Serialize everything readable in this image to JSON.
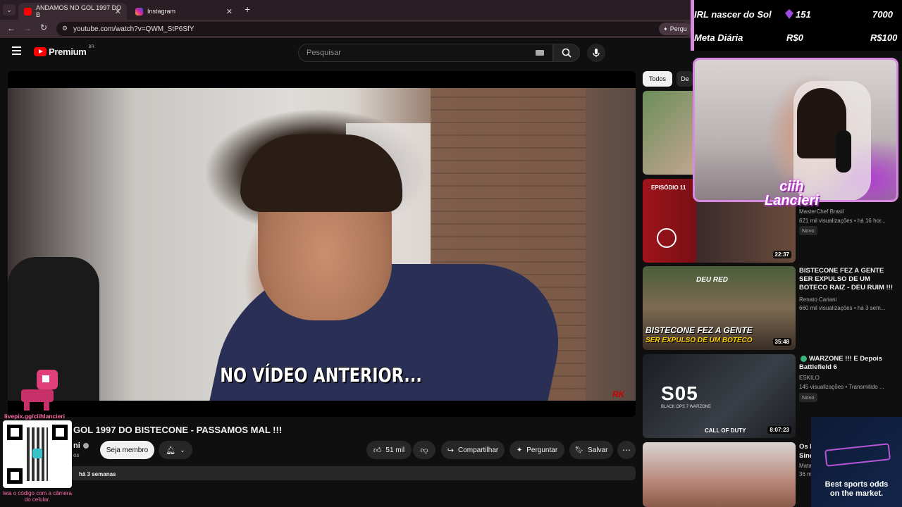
{
  "browser": {
    "tabs": [
      {
        "label": "ANDAMOS NO GOL 1997 DO B",
        "favicon": "youtube-icon",
        "active": true
      },
      {
        "label": "Instagram",
        "favicon": "instagram-icon",
        "active": false
      }
    ],
    "url": "youtube.com/watch?v=QWM_StP6SfY",
    "right_button": "Pergu"
  },
  "youtube": {
    "logo_text": "Premium",
    "logo_superscript": "BR",
    "search_placeholder": "Pesquisar",
    "video": {
      "subtitle": "NO VÍDEO ANTERIOR...",
      "title": "GOL 1997 DO BISTECONE - PASSAMOS MAL !!!",
      "channel_partial": "ni",
      "channel_sub_partial": "os",
      "date_partial": "há 3 semanas",
      "join_label": "Seja membro",
      "like_count": "51 mil",
      "share_label": "Compartilhar",
      "ask_label": "Perguntar",
      "save_label": "Salvar"
    },
    "chips": [
      {
        "label": "Todos",
        "active": true
      },
      {
        "label": "De",
        "active": false
      }
    ],
    "recommendations": [
      {
        "title": "",
        "channel": "MasterChef Brasil",
        "meta": "621 mil visualizações • há 16 hor...",
        "badge": "Novo",
        "duration": "22:37",
        "thumb_text": "EPISÓDIO 11"
      },
      {
        "title": "BISTECONE FEZ A GENTE SER EXPULSO DE UM BOTECO RAIZ - DEU RUIM !!!",
        "channel": "Renato Cariani",
        "meta": "660 mil visualizações • há 3 sem...",
        "duration": "35:48",
        "thumb_text_top": "DEU RED",
        "thumb_text_1": "BISTECONE FEZ A GENTE",
        "thumb_text_2": "SER EXPULSO DE UM BOTECO"
      },
      {
        "title": "WARZONE !!! E Depois Battlefield 6",
        "channel": "ESKILO",
        "meta": "145 visualizações • Transmitido ...",
        "badge": "Novo",
        "duration": "8:07:23",
        "thumb_text": "S05",
        "thumb_sub": "BLACK OPS 7 WARZONE",
        "thumb_brand": "CALL OF DUTY"
      },
      {
        "title": "Os I",
        "title2": "Sinc",
        "channel": "Mata",
        "meta": "36 m"
      }
    ]
  },
  "overlay": {
    "goal_label": "IRL nascer do Sol",
    "goal_current": "151",
    "goal_target": "7000",
    "meta_label": "Meta Diária",
    "meta_current": "R$0",
    "meta_target": "R$100",
    "cam_name_1": "ciih",
    "cam_name_2": "Lancieri",
    "livepix": "livepix.gg/ciihlancieri",
    "qr_caption": "leia o código com a câmera do celular.",
    "sponsor_line1": "Best sports odds",
    "sponsor_line2": "on the market."
  },
  "colors": {
    "youtube_red": "#ff0000",
    "overlay_pink": "#d88ae0",
    "livepix_pink": "#ff6aa8",
    "bg": "#0f0f0f"
  }
}
